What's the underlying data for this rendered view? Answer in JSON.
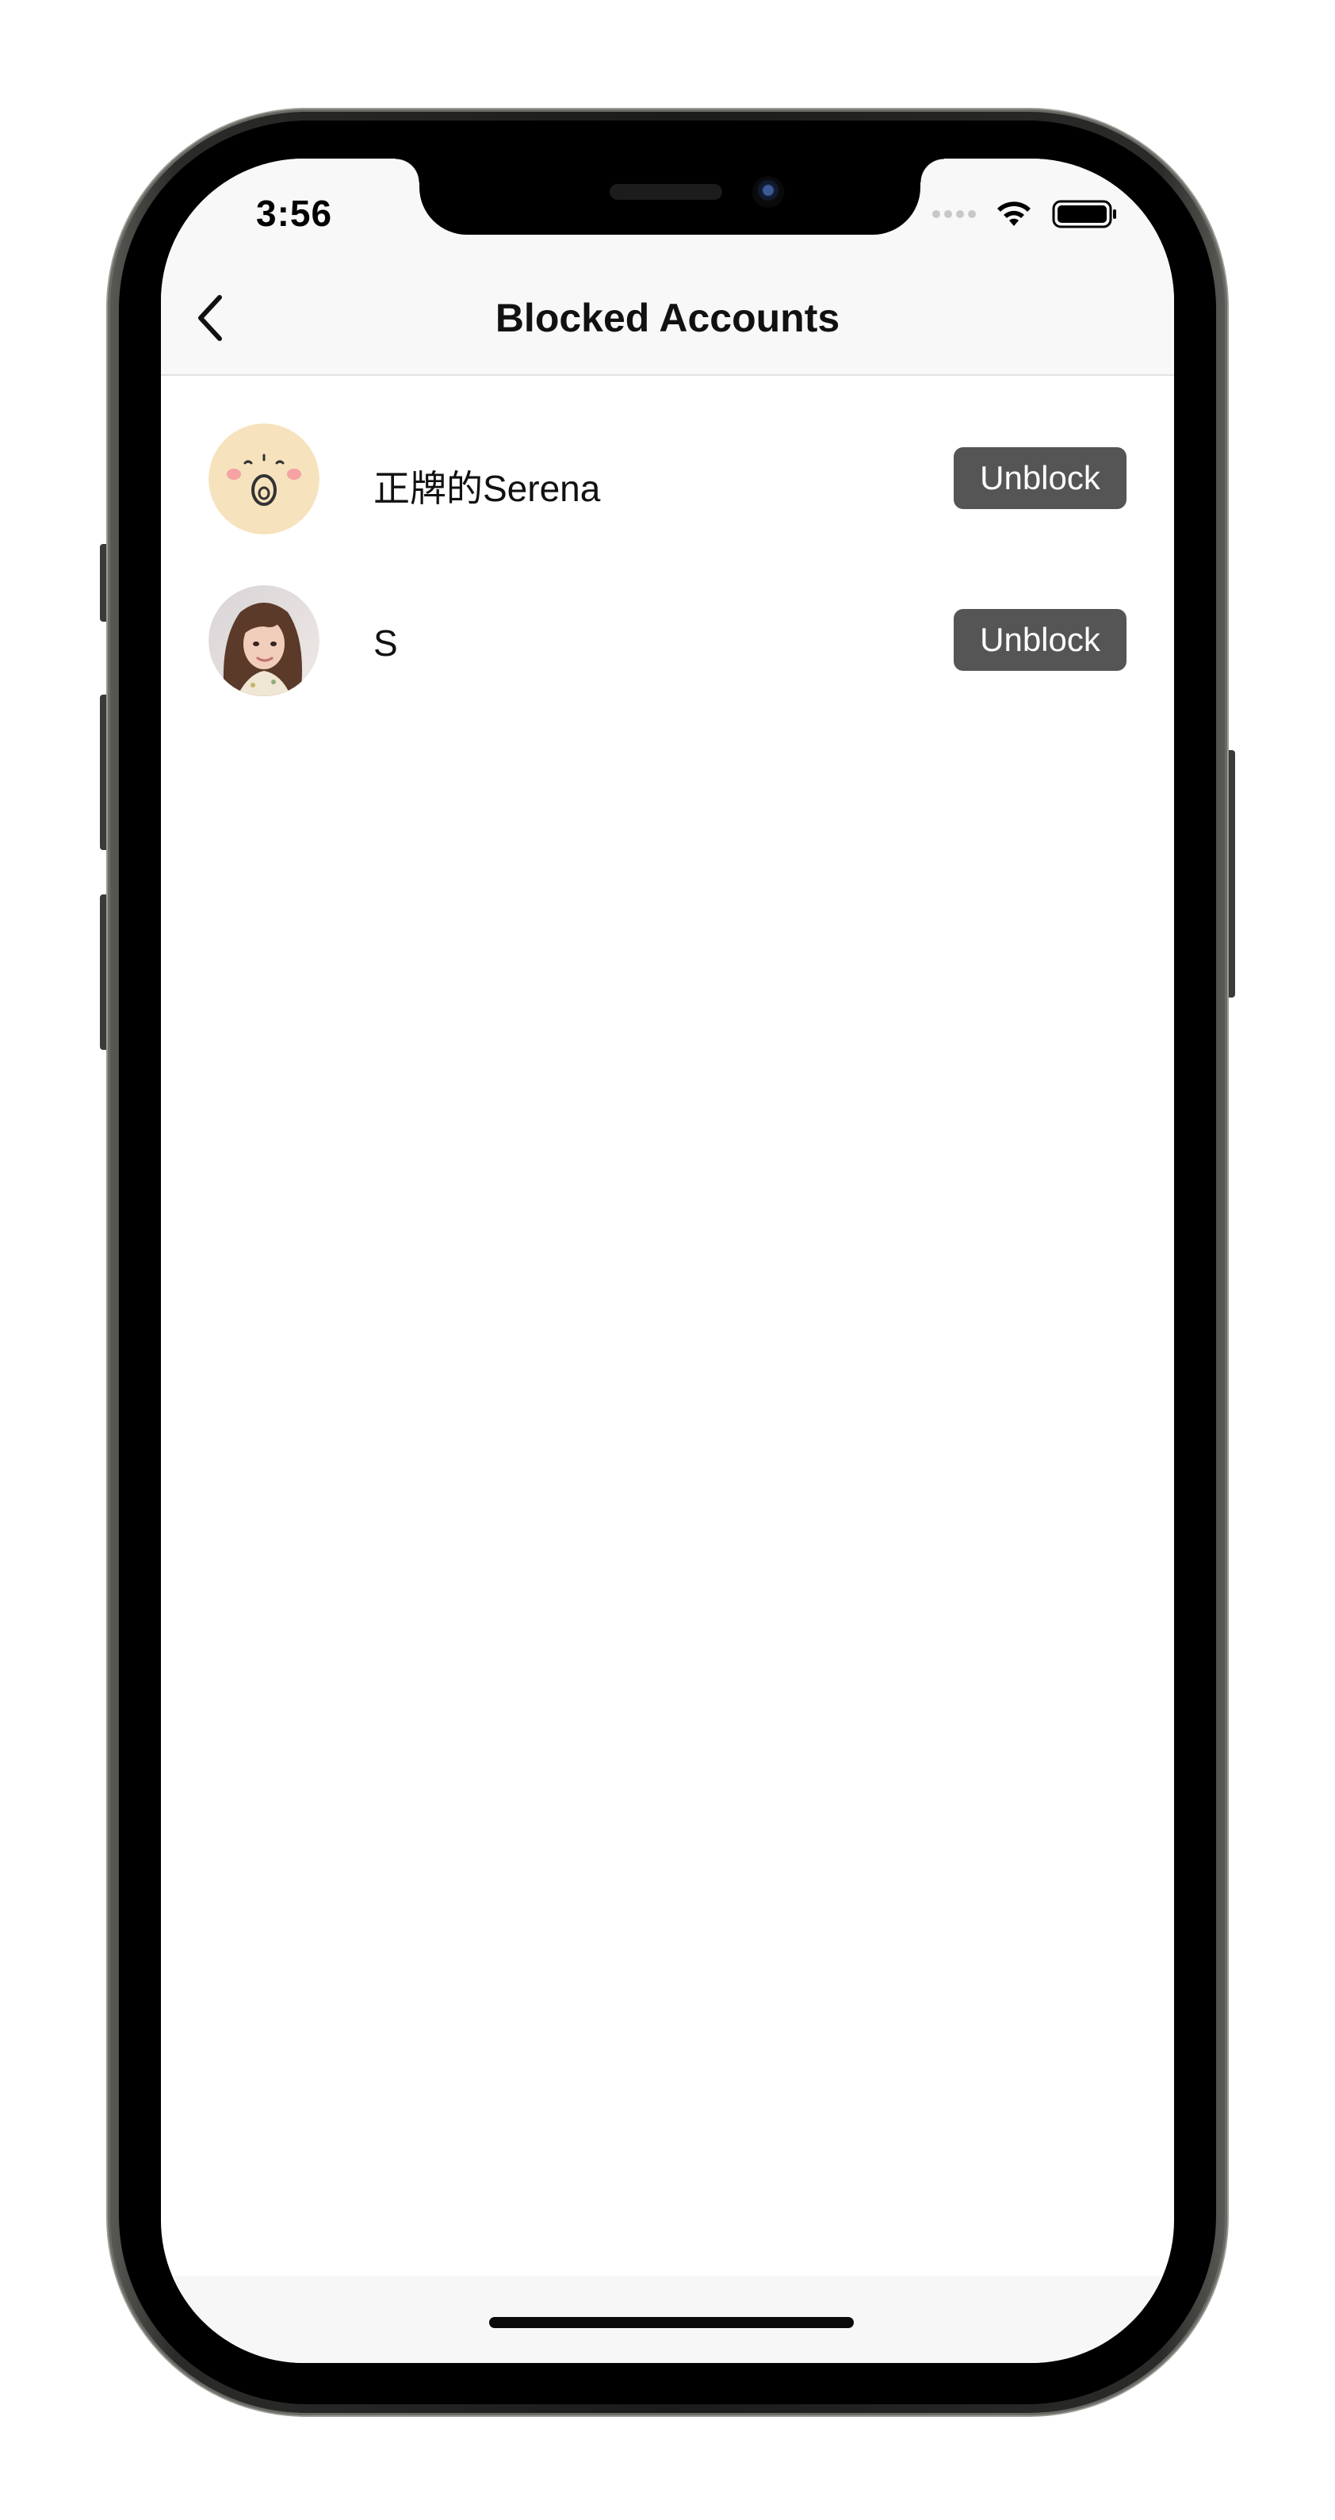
{
  "status_bar": {
    "time": "3:56",
    "icons": [
      "signal-icon",
      "wifi-icon",
      "battery-icon"
    ]
  },
  "nav": {
    "title": "Blocked Accounts",
    "back_icon": "chevron-left-icon"
  },
  "blocked_accounts": [
    {
      "name": "正牌的Serena",
      "button_label": "Unblock",
      "avatar": "cartoon-face-avatar"
    },
    {
      "name": "S",
      "button_label": "Unblock",
      "avatar": "photo-avatar"
    }
  ],
  "colors": {
    "button_bg": "#555555",
    "button_text": "#ffffff",
    "nav_bg": "#f8f8f8",
    "cartoon_avatar_bg": "#f6e3bd"
  }
}
